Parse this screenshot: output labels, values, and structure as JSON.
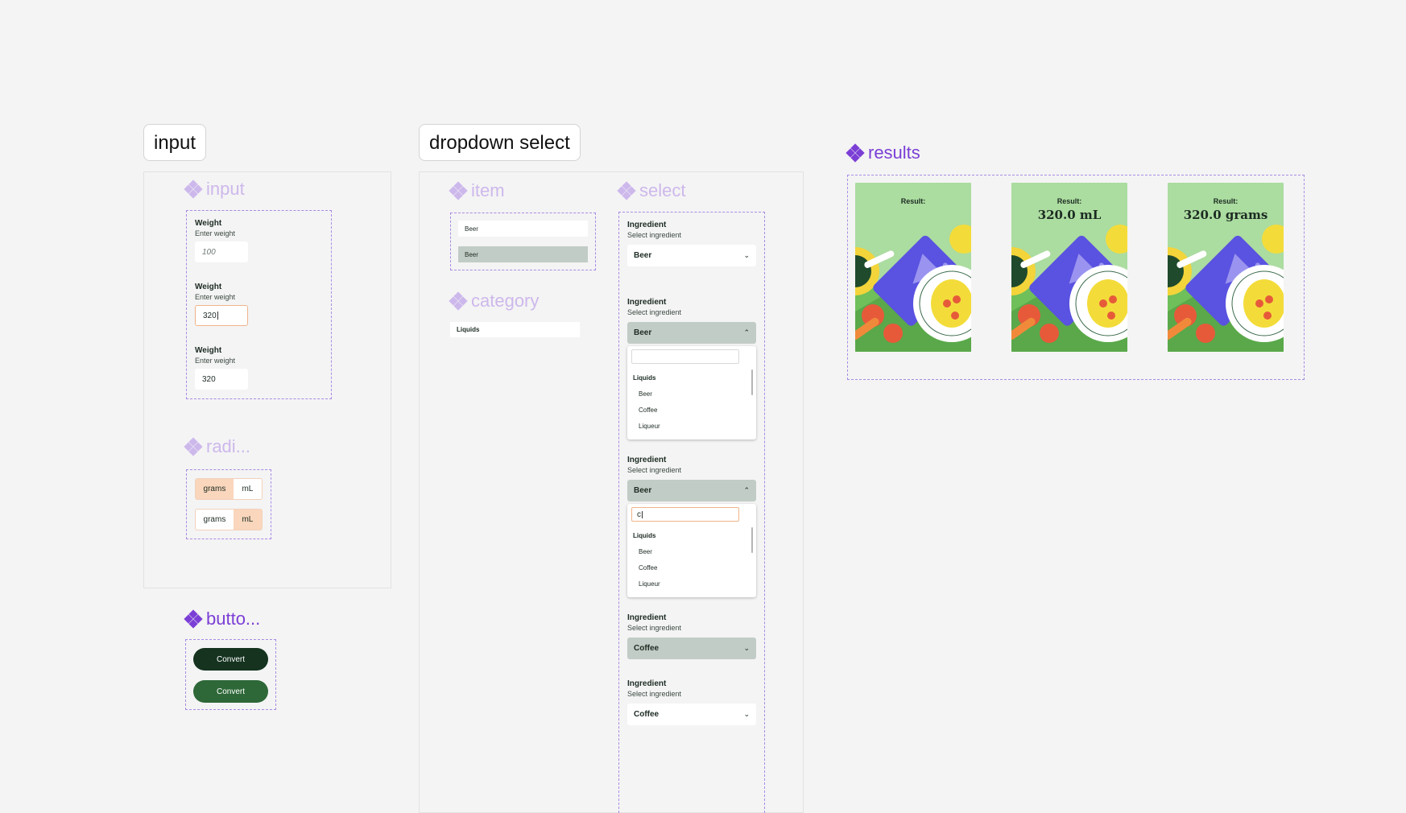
{
  "sections": {
    "input": "input",
    "dropdown": "dropdown select",
    "results": "results"
  },
  "components": {
    "input": "input",
    "radio": "radi...",
    "button": "butto...",
    "item": "item",
    "category": "category",
    "select": "select"
  },
  "inputs": [
    {
      "label": "Weight",
      "sub": "Enter weight",
      "value": "100",
      "state": "placeholder"
    },
    {
      "label": "Weight",
      "sub": "Enter weight",
      "value": "320",
      "state": "focused"
    },
    {
      "label": "Weight",
      "sub": "Enter weight",
      "value": "320",
      "state": "filled"
    }
  ],
  "radios": [
    {
      "a": "grams",
      "b": "mL",
      "selected": "grams"
    },
    {
      "a": "grams",
      "b": "mL",
      "selected": "mL"
    }
  ],
  "buttons": [
    {
      "label": "Convert",
      "color": "#15331f"
    },
    {
      "label": "Convert",
      "color": "#2e6838"
    }
  ],
  "items": [
    {
      "label": "Beer",
      "state": "default"
    },
    {
      "label": "Beer",
      "state": "hover"
    }
  ],
  "category": {
    "label": "Liquids"
  },
  "selects": [
    {
      "label": "Ingredient",
      "sub": "Select ingredient",
      "value": "Beer",
      "state": "closed"
    },
    {
      "label": "Ingredient",
      "sub": "Select ingredient",
      "value": "Beer",
      "state": "open",
      "search": "",
      "category": "Liquids",
      "options": [
        "Beer",
        "Coffee",
        "Liqueur"
      ]
    },
    {
      "label": "Ingredient",
      "sub": "Select ingredient",
      "value": "Beer",
      "state": "open-search",
      "search": "c",
      "category": "Liquids",
      "options": [
        "Beer",
        "Coffee",
        "Liqueur"
      ]
    },
    {
      "label": "Ingredient",
      "sub": "Select ingredient",
      "value": "Coffee",
      "state": "hover"
    },
    {
      "label": "Ingredient",
      "sub": "Select ingredient",
      "value": "Coffee",
      "state": "closed"
    }
  ],
  "results": [
    {
      "label": "Result:",
      "value": ""
    },
    {
      "label": "Result:",
      "value": "320.0 mL"
    },
    {
      "label": "Result:",
      "value": "320.0 grams"
    }
  ],
  "colors": {
    "accent": "#7b3fd6",
    "accent_light": "#cdb8ec",
    "focus_border": "#f0b48a",
    "segment_on": "#f9d6bc",
    "card_bg": "#abdca0"
  },
  "icons": [
    "component-icon",
    "chevron-down-icon",
    "chevron-up-icon"
  ]
}
